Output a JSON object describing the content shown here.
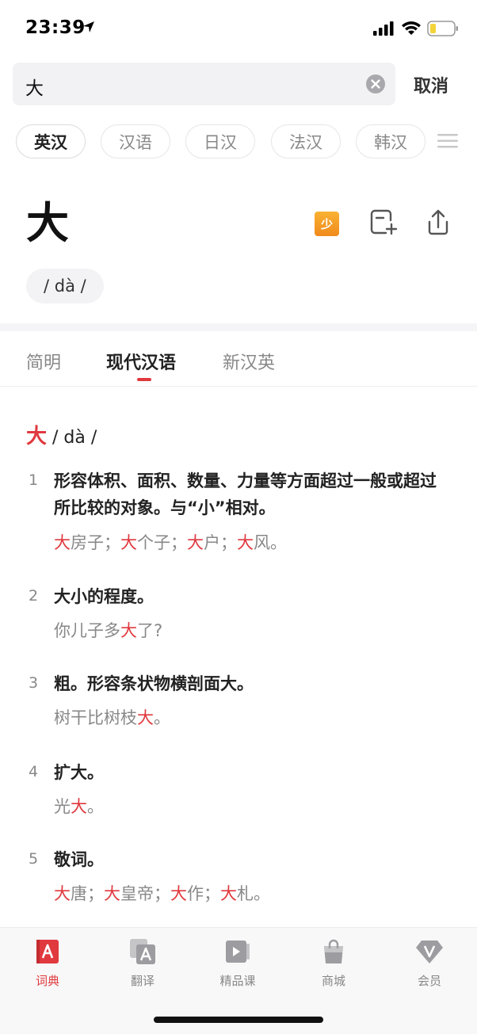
{
  "status_bar": {
    "time": "23:39",
    "icons": [
      "location-arrow-icon",
      "cellular-signal-icon",
      "wifi-icon",
      "battery-low-icon"
    ]
  },
  "search": {
    "value": "大",
    "cancel_label": "取消"
  },
  "language_tabs": [
    {
      "label": "英汉",
      "active": true
    },
    {
      "label": "汉语",
      "active": false
    },
    {
      "label": "日汉",
      "active": false
    },
    {
      "label": "法汉",
      "active": false
    },
    {
      "label": "韩汉",
      "active": false
    }
  ],
  "word": {
    "headword": "大",
    "level_badge": "少",
    "pinyin": "/ dà /"
  },
  "content_tabs": [
    {
      "label": "简明",
      "active": false
    },
    {
      "label": "现代汉语",
      "active": true
    },
    {
      "label": "新汉英",
      "active": false
    }
  ],
  "entry": {
    "headword": "大",
    "pinyin": " / dà /",
    "senses": [
      {
        "num": "1",
        "definition": "形容体积、面积、数量、力量等方面超过一般或超过所比较的对象。与“小”相对。",
        "example": "大房子；大个子；大户；大风。"
      },
      {
        "num": "2",
        "definition": "大小的程度。",
        "example": "你儿子多大了?"
      },
      {
        "num": "3",
        "definition": "粗。形容条状物横剖面大。",
        "example": "树干比树枝大。"
      },
      {
        "num": "4",
        "definition": "扩大。",
        "example": "光大。"
      },
      {
        "num": "5",
        "definition": "敬词。",
        "example": "大唐；大皇帝；大作；大札。"
      }
    ]
  },
  "bottom_nav": [
    {
      "label": "词典",
      "icon": "dictionary-icon",
      "active": true
    },
    {
      "label": "翻译",
      "icon": "translate-icon",
      "active": false
    },
    {
      "label": "精品课",
      "icon": "video-course-icon",
      "active": false
    },
    {
      "label": "商城",
      "icon": "shopping-bag-icon",
      "active": false
    },
    {
      "label": "会员",
      "icon": "vip-diamond-icon",
      "active": false
    }
  ],
  "colors": {
    "accent": "#e0393e",
    "badge": "#f5a02a"
  }
}
